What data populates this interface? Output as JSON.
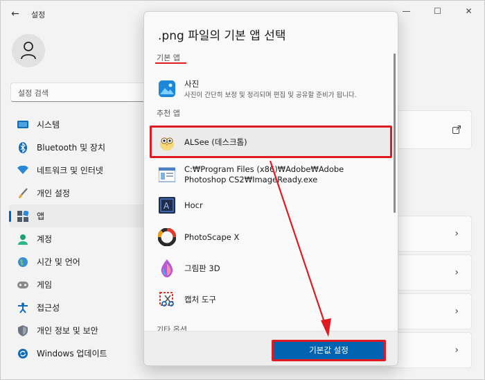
{
  "window": {
    "title": "설정",
    "back_icon": "←",
    "controls": [
      "—",
      "☐",
      "✕"
    ]
  },
  "search": {
    "placeholder": "설정 검색"
  },
  "nav": [
    {
      "label": "시스템",
      "icon": "monitor-icon"
    },
    {
      "label": "Bluetooth 및 장치",
      "icon": "bluetooth-icon"
    },
    {
      "label": "네트워크 및 인터넷",
      "icon": "wifi-icon"
    },
    {
      "label": "개인 설정",
      "icon": "brush-icon"
    },
    {
      "label": "앱",
      "icon": "apps-icon",
      "active": true
    },
    {
      "label": "계정",
      "icon": "account-icon"
    },
    {
      "label": "시간 및 언어",
      "icon": "globe-icon"
    },
    {
      "label": "게임",
      "icon": "gamepad-icon"
    },
    {
      "label": "접근성",
      "icon": "accessibility-icon"
    },
    {
      "label": "개인 정보 및 보안",
      "icon": "shield-icon"
    },
    {
      "label": "Windows 업데이트",
      "icon": "update-icon"
    }
  ],
  "dialog": {
    "title": ".png 파일의 기본 앱 선택",
    "default_section": "기본 앱",
    "recommended_section": "추천 앱",
    "other_section": "기타 옵션",
    "default_app": {
      "name": "사진",
      "description": "사진이 간단히 보정 및 정리되며 편집 및 공유할 준비가 됩니다."
    },
    "apps": [
      {
        "name": "ALSee (데스크톱)",
        "icon": "alsee-icon"
      },
      {
        "name": "C:₩Program Files (x86)₩Adobe₩Adobe Photoshop CS2₩ImageReady.exe",
        "icon": "imageready-icon"
      },
      {
        "name": "Hocr",
        "icon": "hocr-icon"
      },
      {
        "name": "PhotoScape X",
        "icon": "photoscape-icon"
      },
      {
        "name": "그림판 3D",
        "icon": "paint3d-icon"
      },
      {
        "name": "캡처 도구",
        "icon": "snipping-tool-icon"
      }
    ],
    "confirm_label": "기본값 설정"
  },
  "colors": {
    "accent": "#0063b1",
    "highlight": "#e01a22"
  }
}
